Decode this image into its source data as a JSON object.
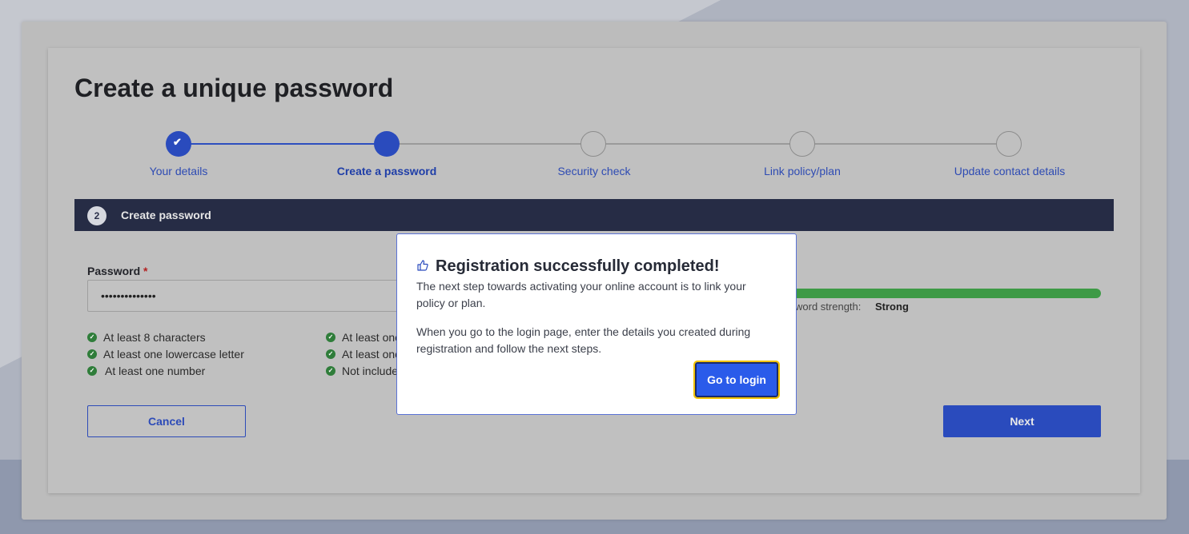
{
  "page": {
    "title": "Create a unique password"
  },
  "stepper": {
    "steps": [
      {
        "label": "Your details",
        "state": "done"
      },
      {
        "label": "Create a password",
        "state": "current"
      },
      {
        "label": "Security check",
        "state": "todo"
      },
      {
        "label": "Link policy/plan",
        "state": "todo"
      },
      {
        "label": "Update contact details",
        "state": "todo"
      }
    ]
  },
  "section": {
    "number": "2",
    "title": "Create password"
  },
  "form": {
    "password_label": "Password",
    "required_marker": "*",
    "password_value": "••••••••••••••",
    "strength_label": "word strength:",
    "strength_value": "Strong",
    "strength_percent": 100,
    "rules": [
      "At least 8 characters",
      "At least one lowercase letter",
      "At least one number",
      "At least one",
      "At least one",
      "Not include"
    ],
    "cancel_label": "Cancel",
    "next_label": "Next"
  },
  "modal": {
    "title": "Registration successfully completed!",
    "paragraph1": "The next step towards activating your online account is to link your policy or plan.",
    "paragraph2": "When you go to the login page, enter the details you created during registration and follow the next steps.",
    "button_label": "Go to login",
    "icon": "thumbs-up-icon"
  },
  "colors": {
    "accent": "#2a4bbd",
    "section_bar": "#262c45",
    "strength": "#3e9a46",
    "focus_outline": "#f2c200"
  }
}
